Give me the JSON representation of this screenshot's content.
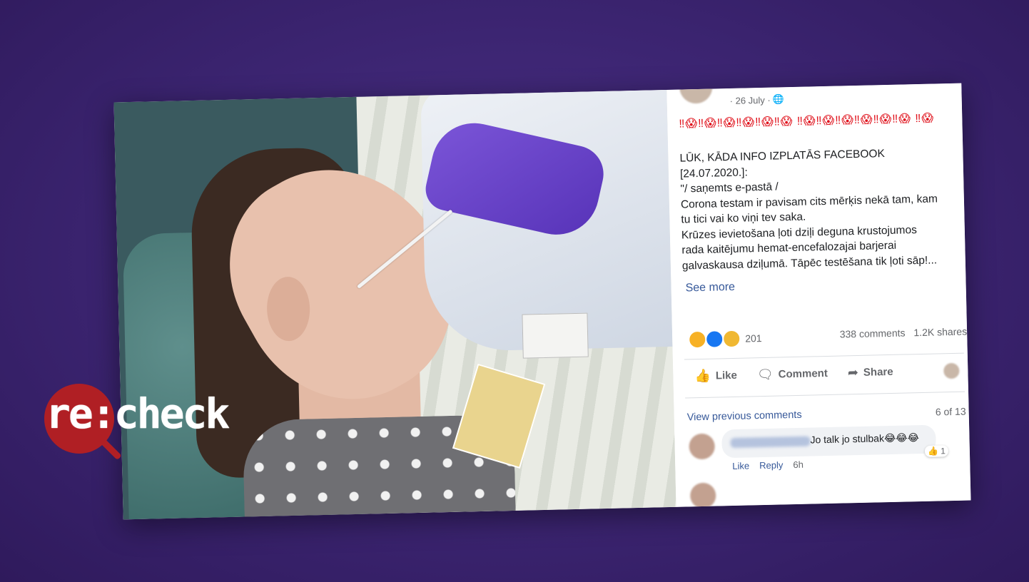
{
  "logo": {
    "text": "re:check",
    "accent_color": "#b01f24"
  },
  "post": {
    "date": "· 26 July ·",
    "privacy_icon": "globe-icon",
    "emoji_line": "‼😱‼😱‼😱‼😱‼😱‼😱 ‼😱‼😱‼😱‼😱‼😱‼😱 ‼😱",
    "body": "LŪK, KĀDA INFO IZPLATĀS FACEBOOK\n[24.07.2020.]:\n\"/ saņemts e-pastā /\nCorona testam ir pavisam cits mērķis nekā tam, kam\ntu tici vai ko viņi tev saka.\nKrūzes ievietošana ļoti dziļi deguna krustojumos\nrada kaitējumu hemat-encefalozajai barjerai\ngalvaskausa dziļumā. Tāpēc testēšana tik ļoti sāp!...",
    "see_more": "See more",
    "reaction_count": "201",
    "comments": "338 comments",
    "shares": "1.2K shares"
  },
  "actions": {
    "like": "Like",
    "comment": "Comment",
    "share": "Share"
  },
  "comments_section": {
    "view_previous": "View previous comments",
    "count": "6 of 13",
    "comment_text": "Jo talk jo stulbak😂😂😂",
    "reaction_count": "1",
    "like": "Like",
    "reply": "Reply",
    "time": "6h"
  },
  "colors": {
    "background": "#3b2470",
    "link": "#365899",
    "emoji_red": "#e0141e"
  }
}
